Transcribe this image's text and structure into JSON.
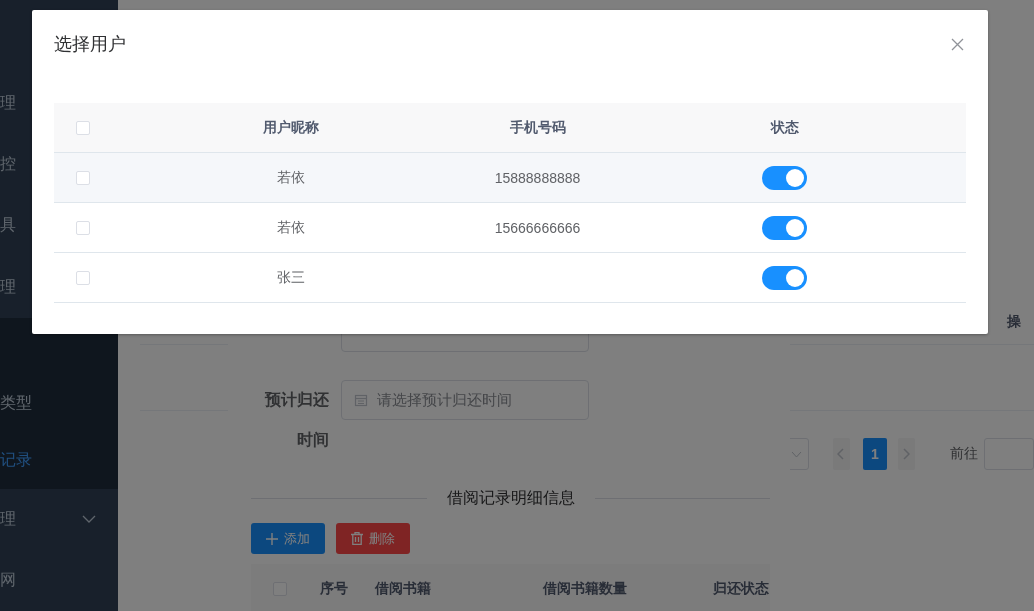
{
  "sidebar": {
    "items": [
      {
        "label": "理"
      },
      {
        "label": "控"
      },
      {
        "label": "具"
      },
      {
        "label": "理",
        "children": [
          {
            "label": "类型",
            "selected": false
          },
          {
            "label": "记录",
            "selected": true
          }
        ]
      },
      {
        "label": "理",
        "expanded": false
      },
      {
        "label": "网"
      }
    ]
  },
  "main": {
    "table": {
      "columns": [
        "操"
      ]
    },
    "pagination": {
      "pages": [
        {
          "label": "1",
          "selected": true
        }
      ],
      "jump_label": "前往"
    }
  },
  "borrow_dialog": {
    "fields": [
      {
        "label": "预计归还时间",
        "placeholder": "请选择预计归还时间"
      }
    ],
    "section_title": "借阅记录明细信息",
    "buttons": [
      {
        "label": "添加",
        "kind": "add"
      },
      {
        "label": "删除",
        "kind": "delete"
      }
    ],
    "table": {
      "all_checked": false,
      "columns": [
        "序号",
        "借阅书籍",
        "借阅书籍数量",
        "归还状态"
      ]
    }
  },
  "user_dialog": {
    "title": "选择用户",
    "all_checked": false,
    "columns": [
      "用户昵称",
      "手机号码",
      "状态"
    ],
    "rows": [
      {
        "checked": false,
        "nickname": "若依",
        "phone": "15888888888",
        "status_on": true
      },
      {
        "checked": false,
        "nickname": "若依",
        "phone": "15666666666",
        "status_on": true
      },
      {
        "checked": false,
        "nickname": "张三",
        "status_on": true
      }
    ]
  }
}
